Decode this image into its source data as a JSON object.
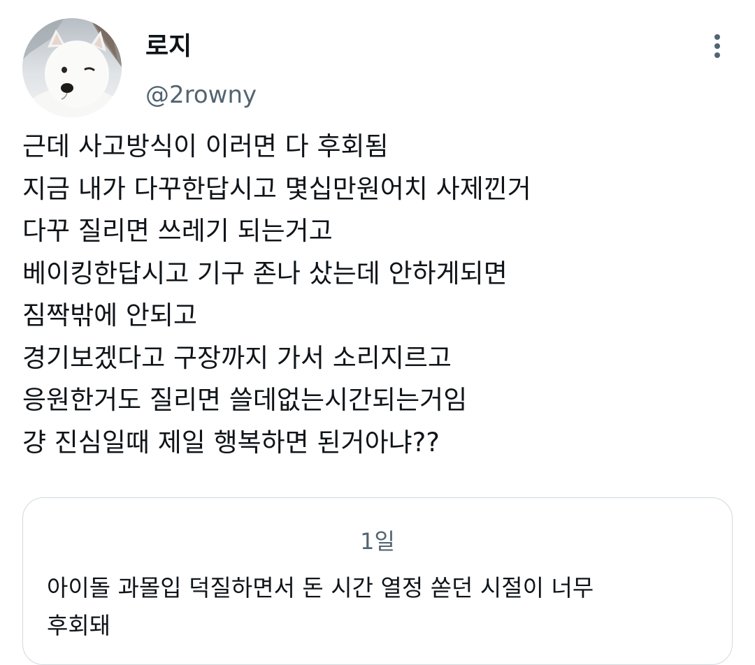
{
  "author": {
    "display_name": "로지",
    "handle": "@2rowny",
    "avatar_icon": "samoyed-dog-avatar"
  },
  "more_icon": "more-vertical-icon",
  "tweet": {
    "lines": [
      "근데 사고방식이 이러면 다 후회됨",
      "지금 내가 다꾸한답시고 몇십만원어치 사제낀거",
      "다꾸 질리면 쓰레기 되는거고",
      "베이킹한답시고 기구 존나 샀는데 안하게되면",
      "짐짝밖에 안되고",
      "경기보겠다고 구장까지 가서 소리지르고",
      "응원한거도 질리면 쓸데없는시간되는거임",
      "걍 진심일때 제일 행복하면 된거아냐??"
    ]
  },
  "quote": {
    "timestamp": "1일",
    "lines": [
      "아이돌 과몰입 덕질하면서 돈 시간 열정 쏟던 시절이 너무",
      "후회돼"
    ]
  },
  "colors": {
    "text_primary": "#0f1419",
    "text_secondary": "#536471",
    "border": "#cfd9de",
    "background": "#ffffff"
  }
}
